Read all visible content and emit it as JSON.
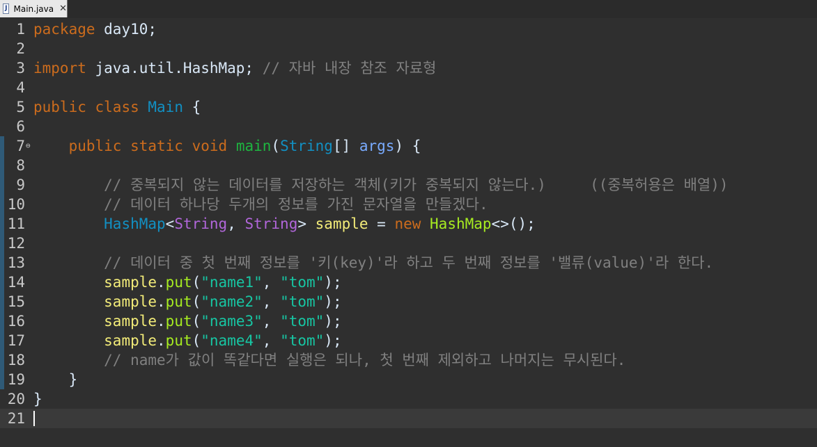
{
  "tab": {
    "label": "Main.java",
    "icon": "java-file-icon",
    "close": "✕"
  },
  "lines": [
    {
      "num": "1",
      "tokens": [
        [
          "kw",
          "package"
        ],
        [
          "p",
          " day10;"
        ]
      ]
    },
    {
      "num": "2",
      "tokens": []
    },
    {
      "num": "3",
      "tokens": [
        [
          "kw",
          "import"
        ],
        [
          "p",
          " java.util.HashMap; "
        ],
        [
          "com",
          "// 자바 내장 참조 자료형"
        ]
      ]
    },
    {
      "num": "4",
      "tokens": []
    },
    {
      "num": "5",
      "tokens": [
        [
          "kw",
          "public"
        ],
        [
          "p",
          " "
        ],
        [
          "kw",
          "class"
        ],
        [
          "p",
          " "
        ],
        [
          "cls",
          "Main"
        ],
        [
          "p",
          " {"
        ]
      ]
    },
    {
      "num": "6",
      "tokens": []
    },
    {
      "num": "7",
      "fold": true,
      "marker": true,
      "tokens": [
        [
          "p",
          "    "
        ],
        [
          "kw",
          "public"
        ],
        [
          "p",
          " "
        ],
        [
          "kw",
          "static"
        ],
        [
          "p",
          " "
        ],
        [
          "kw",
          "void"
        ],
        [
          "p",
          " "
        ],
        [
          "vmth",
          "main"
        ],
        [
          "p",
          "("
        ],
        [
          "cls",
          "String"
        ],
        [
          "p",
          "[] "
        ],
        [
          "prm",
          "args"
        ],
        [
          "p",
          ") {"
        ]
      ]
    },
    {
      "num": "8",
      "marker": true,
      "tokens": []
    },
    {
      "num": "9",
      "marker": true,
      "tokens": [
        [
          "p",
          "        "
        ],
        [
          "com",
          "// 중복되지 않는 데이터를 저장하는 객체(키가 중복되지 않는다.)     ((중복허용은 배열))"
        ]
      ]
    },
    {
      "num": "10",
      "marker": true,
      "tokens": [
        [
          "p",
          "        "
        ],
        [
          "com",
          "// 데이터 하나당 두개의 정보를 가진 문자열을 만들겠다."
        ]
      ]
    },
    {
      "num": "11",
      "marker": true,
      "tokens": [
        [
          "p",
          "        "
        ],
        [
          "cls",
          "HashMap"
        ],
        [
          "p",
          "<"
        ],
        [
          "gen",
          "String"
        ],
        [
          "p",
          ", "
        ],
        [
          "gen",
          "String"
        ],
        [
          "p",
          "> "
        ],
        [
          "var",
          "sample"
        ],
        [
          "p",
          " = "
        ],
        [
          "kw",
          "new"
        ],
        [
          "p",
          " "
        ],
        [
          "mth",
          "HashMap"
        ],
        [
          "p",
          "<>();"
        ]
      ]
    },
    {
      "num": "12",
      "marker": true,
      "tokens": []
    },
    {
      "num": "13",
      "marker": true,
      "tokens": [
        [
          "p",
          "        "
        ],
        [
          "com",
          "// 데이터 중 첫 번째 정보를 '키(key)'라 하고 두 번째 정보를 '밸류(value)'라 한다."
        ]
      ]
    },
    {
      "num": "14",
      "marker": true,
      "tokens": [
        [
          "p",
          "        "
        ],
        [
          "var",
          "sample"
        ],
        [
          "p",
          "."
        ],
        [
          "mth",
          "put"
        ],
        [
          "p",
          "("
        ],
        [
          "str",
          "\"name1\""
        ],
        [
          "p",
          ", "
        ],
        [
          "str",
          "\"tom\""
        ],
        [
          "p",
          ");"
        ]
      ]
    },
    {
      "num": "15",
      "marker": true,
      "tokens": [
        [
          "p",
          "        "
        ],
        [
          "var",
          "sample"
        ],
        [
          "p",
          "."
        ],
        [
          "mth",
          "put"
        ],
        [
          "p",
          "("
        ],
        [
          "str",
          "\"name2\""
        ],
        [
          "p",
          ", "
        ],
        [
          "str",
          "\"tom\""
        ],
        [
          "p",
          ");"
        ]
      ]
    },
    {
      "num": "16",
      "marker": true,
      "tokens": [
        [
          "p",
          "        "
        ],
        [
          "var",
          "sample"
        ],
        [
          "p",
          "."
        ],
        [
          "mth",
          "put"
        ],
        [
          "p",
          "("
        ],
        [
          "str",
          "\"name3\""
        ],
        [
          "p",
          ", "
        ],
        [
          "str",
          "\"tom\""
        ],
        [
          "p",
          ");"
        ]
      ]
    },
    {
      "num": "17",
      "marker": true,
      "tokens": [
        [
          "p",
          "        "
        ],
        [
          "var",
          "sample"
        ],
        [
          "p",
          "."
        ],
        [
          "mth",
          "put"
        ],
        [
          "p",
          "("
        ],
        [
          "str",
          "\"name4\""
        ],
        [
          "p",
          ", "
        ],
        [
          "str",
          "\"tom\""
        ],
        [
          "p",
          ");"
        ]
      ]
    },
    {
      "num": "18",
      "marker": true,
      "tokens": [
        [
          "p",
          "        "
        ],
        [
          "com",
          "// name가 값이 똑같다면 실행은 되나, 첫 번째 제외하고 나머지는 무시된다."
        ]
      ]
    },
    {
      "num": "19",
      "marker": true,
      "tokens": [
        [
          "p",
          "    }"
        ]
      ]
    },
    {
      "num": "20",
      "tokens": [
        [
          "p",
          "}"
        ]
      ]
    },
    {
      "num": "21",
      "current": true,
      "cursor": true,
      "tokens": []
    }
  ],
  "colors": {
    "background": "#2f2f2f",
    "keyword": "#cc6c1d",
    "type": "#1290c3",
    "string": "#17c6a3",
    "comment": "#808080",
    "field": "#f3ec79",
    "method": "#a7ec21"
  }
}
